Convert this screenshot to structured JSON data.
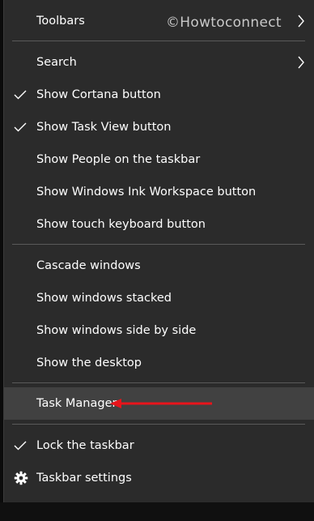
{
  "watermark": "©Howtoconnect",
  "menu": {
    "toolbars": "Toolbars",
    "search": "Search",
    "show_cortana": "Show Cortana button",
    "show_task_view": "Show Task View button",
    "show_people": "Show People on the taskbar",
    "show_ink": "Show Windows Ink Workspace button",
    "show_touch_keyboard": "Show touch keyboard button",
    "cascade": "Cascade windows",
    "stacked": "Show windows stacked",
    "side_by_side": "Show windows side by side",
    "show_desktop": "Show the desktop",
    "task_manager": "Task Manager",
    "lock_taskbar": "Lock the taskbar",
    "taskbar_settings": "Taskbar settings"
  },
  "colors": {
    "menu_bg": "#2b2b2b",
    "highlight": "#414141",
    "annotation_arrow": "#e8141b"
  }
}
